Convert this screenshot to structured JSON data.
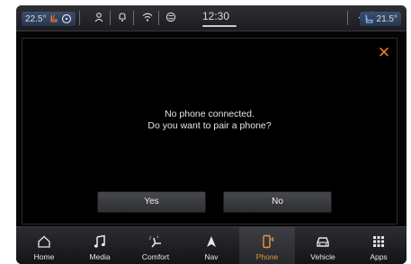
{
  "status_bar": {
    "driver_temp": "22.5°",
    "passenger_temp": "21.5°",
    "clock": "12:30"
  },
  "dialog": {
    "line1": "No phone connected.",
    "line2": "Do you want to pair a phone?",
    "yes_label": "Yes",
    "no_label": "No",
    "close_icon": "close-icon",
    "accent_color": "#ec7f22"
  },
  "nav": {
    "active": "Phone",
    "items": [
      {
        "label": "Home",
        "icon": "home-icon"
      },
      {
        "label": "Media",
        "icon": "music-note-icon"
      },
      {
        "label": "Comfort",
        "icon": "seat-climate-icon"
      },
      {
        "label": "Nav",
        "icon": "navigation-arrow-icon"
      },
      {
        "label": "Phone",
        "icon": "phone-icon"
      },
      {
        "label": "Vehicle",
        "icon": "car-icon"
      },
      {
        "label": "Apps",
        "icon": "grid-icon"
      }
    ]
  }
}
